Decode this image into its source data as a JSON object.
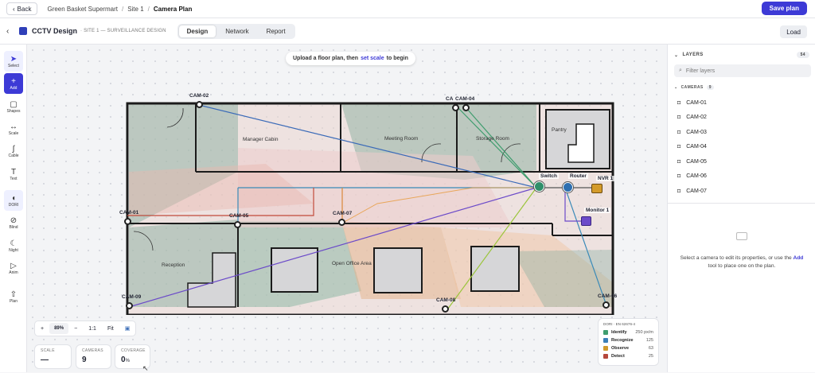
{
  "header": {
    "back_label": "Back",
    "crumbs": [
      "Green Basket Supermart",
      "Site 1",
      "Camera Plan"
    ],
    "save_label": "Save plan"
  },
  "subheader": {
    "title": "CCTV Design",
    "subtitle": "· SITE 1 — SURVEILLANCE DESIGN",
    "tabs": [
      "Design",
      "Network",
      "Report"
    ],
    "active_tab": "Design",
    "load_label": "Load",
    "accent": "#3d3ad6"
  },
  "tools": [
    {
      "label": "Select",
      "icon": "cursor-icon"
    },
    {
      "label": "Add",
      "icon": "plus-icon"
    },
    {
      "label": "Shapes",
      "icon": "square-icon"
    },
    {
      "label": "Scale",
      "icon": "ruler-icon"
    },
    {
      "label": "Cable",
      "icon": "cable-icon"
    },
    {
      "label": "Text",
      "icon": "text-icon"
    },
    {
      "label": "DORI",
      "icon": "dori-icon"
    },
    {
      "label": "Blind",
      "icon": "eye-off-icon"
    },
    {
      "label": "Night",
      "icon": "moon-icon"
    },
    {
      "label": "Anim",
      "icon": "play-icon"
    },
    {
      "label": "Plan",
      "icon": "upload-icon"
    }
  ],
  "hint": {
    "pre": "Upload a floor plan, then",
    "em": "set scale",
    "post": "to begin"
  },
  "floor": {
    "rooms": [
      "Manager Cabin",
      "Meeting Room",
      "Storage Room",
      "Pantry",
      "Reception",
      "Open Office Area"
    ],
    "cameras": [
      "CAM-01",
      "CAM-02",
      "CA",
      "CAM-04",
      "CAM-05",
      "CAM-06",
      "CAM-07",
      "CAM-08",
      "CAM-09"
    ],
    "devices": [
      "Switch",
      "Router",
      "NVR 1",
      "Monitor 1"
    ]
  },
  "zoom": {
    "plus": "+",
    "value": "89%",
    "minus": "−",
    "one": "1:1",
    "fit": "Fit"
  },
  "stats": [
    {
      "label": "SCALE",
      "value": "—",
      "unit": ""
    },
    {
      "label": "CAMERAS",
      "value": "9",
      "unit": ""
    },
    {
      "label": "COVERAGE",
      "value": "0",
      "unit": "%"
    }
  ],
  "dori": {
    "title": "DORI · EN 62676-4",
    "rows": [
      {
        "name": "Identify",
        "value": "250 px/m",
        "color": "#3f9d6e"
      },
      {
        "name": "Recognize",
        "value": "125",
        "color": "#3b7fb8"
      },
      {
        "name": "Observe",
        "value": "63",
        "color": "#d19a2c"
      },
      {
        "name": "Detect",
        "value": "25",
        "color": "#b5473c"
      }
    ]
  },
  "layers": {
    "title": "LAYERS",
    "count": "54",
    "filter_placeholder": "Filter layers",
    "cameras_title": "CAMERAS",
    "cameras_count": "9",
    "cameras": [
      "CAM-01",
      "CAM-02",
      "CAM-03",
      "CAM-04",
      "CAM-05",
      "CAM-06",
      "CAM-07"
    ]
  },
  "empty": {
    "pre": "Select a camera to edit its properties, or use the",
    "em": "Add",
    "post": "tool to place one on the plan."
  }
}
